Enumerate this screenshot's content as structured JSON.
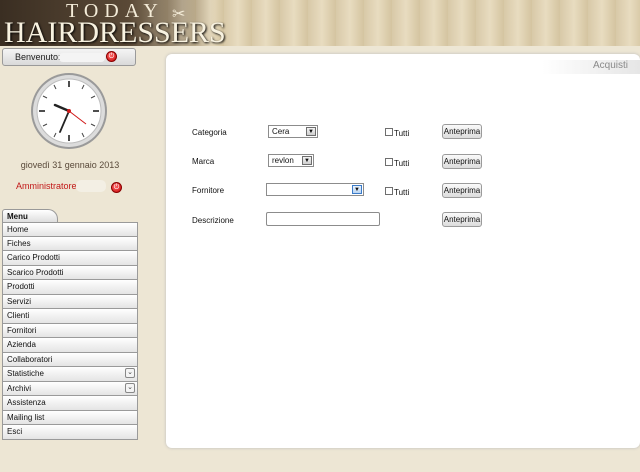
{
  "header": {
    "logo_top": "TODAY",
    "logo_main": "HAIRDRESSERS"
  },
  "sidebar": {
    "welcome_label": "Benvenuto:",
    "date_text": "giovedì 31 gennaio 2013",
    "admin_label": "Amministratore :",
    "clock_time": "9:38",
    "menu_tab": "Menu",
    "menu_items": [
      {
        "label": "Home"
      },
      {
        "label": "Fiches"
      },
      {
        "label": "Carico Prodotti"
      },
      {
        "label": "Scarico Prodotti"
      },
      {
        "label": "Prodotti"
      },
      {
        "label": "Servizi"
      },
      {
        "label": "Clienti"
      },
      {
        "label": "Fornitori"
      },
      {
        "label": "Azienda"
      },
      {
        "label": "Collaboratori"
      },
      {
        "label": "Statistiche",
        "expandable": true
      },
      {
        "label": "Archivi",
        "expandable": true
      },
      {
        "label": "Assistenza"
      },
      {
        "label": "Mailing list"
      },
      {
        "label": "Esci"
      }
    ],
    "expand_glyph": "⌄"
  },
  "main": {
    "title": "Acquisti",
    "rows": [
      {
        "label": "Categoria",
        "value": "Cera",
        "checkbox_label": "Tutti",
        "button": "Anteprima"
      },
      {
        "label": "Marca",
        "value": "revlon",
        "checkbox_label": "Tutti",
        "button": "Anteprima"
      },
      {
        "label": "Fornitore",
        "value": "",
        "checkbox_label": "Tutti",
        "button": "Anteprima"
      },
      {
        "label": "Descrizione",
        "value": "",
        "button": "Anteprima"
      }
    ]
  },
  "colors": {
    "accent_red": "#c21818",
    "page_bg": "#ede6d4"
  }
}
